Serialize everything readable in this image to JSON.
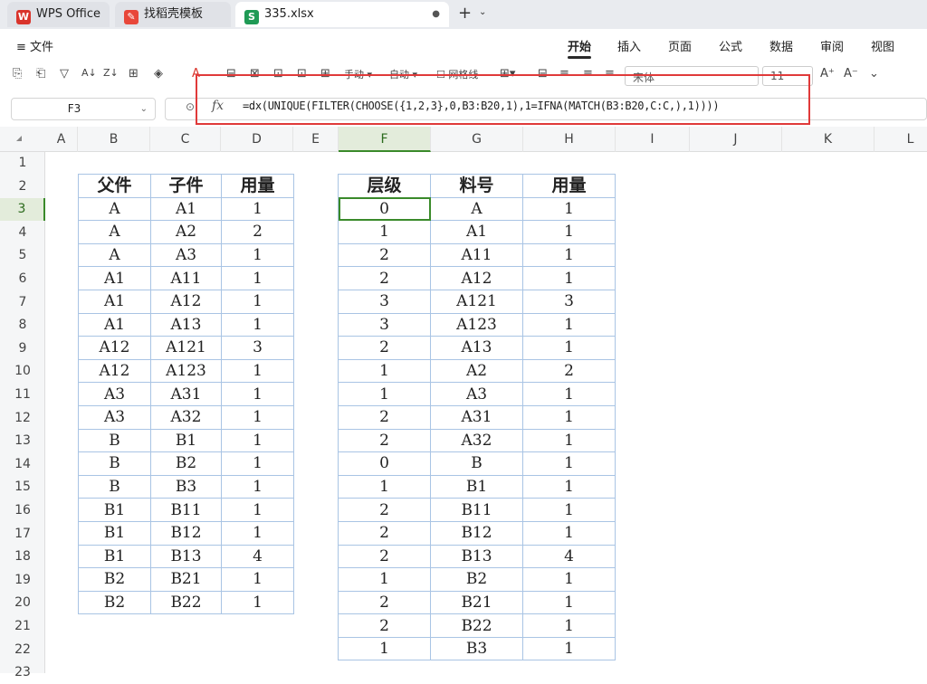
{
  "tabs": {
    "tab1": "WPS Office",
    "tab2": "找稻壳模板",
    "tab3": "335.xlsx"
  },
  "menu": {
    "file": "≡ 文件",
    "ribbon": [
      "开始",
      "插入",
      "页面",
      "公式",
      "数据",
      "审阅",
      "视图"
    ]
  },
  "toolbar": {
    "manual": "手动",
    "auto": "自动",
    "gridlines": "网格线",
    "font": "宋体",
    "size": "11"
  },
  "formula": {
    "cell": "F3",
    "text": "=dx(UNIQUE(FILTER(CHOOSE({1,2,3},0,B3:B20,1),1=IFNA(MATCH(B3:B20,C:C,),1))))"
  },
  "columns": [
    "A",
    "B",
    "C",
    "D",
    "E",
    "F",
    "G",
    "H",
    "I",
    "J",
    "K",
    "L"
  ],
  "rows": [
    "1",
    "2",
    "3",
    "4",
    "5",
    "6",
    "7",
    "8",
    "9",
    "10",
    "11",
    "12",
    "13",
    "14",
    "15",
    "16",
    "17",
    "18",
    "19",
    "20",
    "21",
    "22",
    "23"
  ],
  "left_table": {
    "headers": [
      "父件",
      "子件",
      "用量"
    ],
    "rows": [
      [
        "A",
        "A1",
        "1"
      ],
      [
        "A",
        "A2",
        "2"
      ],
      [
        "A",
        "A3",
        "1"
      ],
      [
        "A1",
        "A11",
        "1"
      ],
      [
        "A1",
        "A12",
        "1"
      ],
      [
        "A1",
        "A13",
        "1"
      ],
      [
        "A12",
        "A121",
        "3"
      ],
      [
        "A12",
        "A123",
        "1"
      ],
      [
        "A3",
        "A31",
        "1"
      ],
      [
        "A3",
        "A32",
        "1"
      ],
      [
        "B",
        "B1",
        "1"
      ],
      [
        "B",
        "B2",
        "1"
      ],
      [
        "B",
        "B3",
        "1"
      ],
      [
        "B1",
        "B11",
        "1"
      ],
      [
        "B1",
        "B12",
        "1"
      ],
      [
        "B1",
        "B13",
        "4"
      ],
      [
        "B2",
        "B21",
        "1"
      ],
      [
        "B2",
        "B22",
        "1"
      ]
    ]
  },
  "right_table": {
    "headers": [
      "层级",
      "料号",
      "用量"
    ],
    "rows": [
      [
        "0",
        "A",
        "1"
      ],
      [
        "1",
        "A1",
        "1"
      ],
      [
        "2",
        "A11",
        "1"
      ],
      [
        "2",
        "A12",
        "1"
      ],
      [
        "3",
        "A121",
        "3"
      ],
      [
        "3",
        "A123",
        "1"
      ],
      [
        "2",
        "A13",
        "1"
      ],
      [
        "1",
        "A2",
        "2"
      ],
      [
        "1",
        "A3",
        "1"
      ],
      [
        "2",
        "A31",
        "1"
      ],
      [
        "2",
        "A32",
        "1"
      ],
      [
        "0",
        "B",
        "1"
      ],
      [
        "1",
        "B1",
        "1"
      ],
      [
        "2",
        "B11",
        "1"
      ],
      [
        "2",
        "B12",
        "1"
      ],
      [
        "2",
        "B13",
        "4"
      ],
      [
        "1",
        "B2",
        "1"
      ],
      [
        "2",
        "B21",
        "1"
      ],
      [
        "2",
        "B22",
        "1"
      ],
      [
        "1",
        "B3",
        "1"
      ]
    ]
  }
}
